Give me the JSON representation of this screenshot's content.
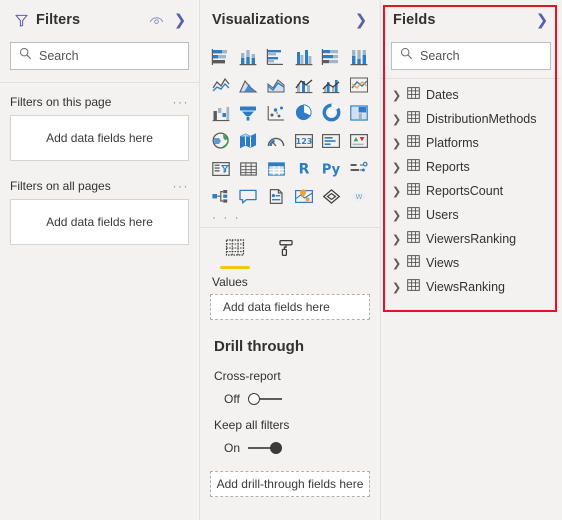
{
  "filters": {
    "title": "Filters",
    "eye_icon": "eye-icon",
    "expand_icon": "chevron-right-icon",
    "search": {
      "placeholder": "Search",
      "icon": "search-icon"
    },
    "groups": [
      {
        "label": "Filters on this page",
        "menu": "···",
        "dropzone": "Add data fields here"
      },
      {
        "label": "Filters on all pages",
        "menu": "···",
        "dropzone": "Add data fields here"
      }
    ]
  },
  "visualizations": {
    "title": "Visualizations",
    "expand_icon": "chevron-right-icon",
    "more_label": "· · ·",
    "icons": [
      "stacked-bar-chart-icon",
      "stacked-column-chart-icon",
      "clustered-bar-chart-icon",
      "clustered-column-chart-icon",
      "hundred-percent-stacked-bar-chart-icon",
      "hundred-percent-stacked-column-chart-icon",
      "line-chart-icon",
      "area-chart-icon",
      "stacked-area-chart-icon",
      "line-and-stacked-column-chart-icon",
      "line-and-clustered-column-chart-icon",
      "ribbon-chart-icon",
      "waterfall-chart-icon",
      "funnel-chart-icon",
      "scatter-chart-icon",
      "pie-chart-icon",
      "donut-chart-icon",
      "treemap-icon",
      "map-icon",
      "filled-map-icon",
      "gauge-icon",
      "card-icon",
      "multi-row-card-icon",
      "kpi-icon",
      "slicer-icon",
      "table-icon",
      "matrix-icon",
      "r-script-visual-icon",
      "python-visual-icon",
      "decomposition-tree-icon",
      "key-influencers-icon",
      "qanda-icon",
      "smart-narrative-icon",
      "arcgis-map-icon",
      "power-apps-icon",
      "word-cloud-icon"
    ],
    "tabs": [
      {
        "name": "fields-tab",
        "icon": "fields-table-icon",
        "active": true
      },
      {
        "name": "format-tab",
        "icon": "paint-roller-icon",
        "active": false
      }
    ],
    "values_label": "Values",
    "values_dropzone": "Add data fields here",
    "drill_through": {
      "title": "Drill through",
      "cross_report": {
        "label": "Cross-report",
        "state": "Off",
        "on": false
      },
      "keep_all_filters": {
        "label": "Keep all filters",
        "state": "On",
        "on": true
      },
      "dropzone": "Add drill-through fields here"
    }
  },
  "fields": {
    "title": "Fields",
    "expand_icon": "chevron-right-icon",
    "search": {
      "placeholder": "Search",
      "icon": "search-icon"
    },
    "tables": [
      {
        "name": "Dates",
        "icon": "table-icon",
        "chevron": "chevron-right-icon"
      },
      {
        "name": "DistributionMethods",
        "icon": "table-icon",
        "chevron": "chevron-right-icon"
      },
      {
        "name": "Platforms",
        "icon": "table-icon",
        "chevron": "chevron-right-icon"
      },
      {
        "name": "Reports",
        "icon": "table-icon",
        "chevron": "chevron-right-icon"
      },
      {
        "name": "ReportsCount",
        "icon": "table-icon",
        "chevron": "chevron-right-icon"
      },
      {
        "name": "Users",
        "icon": "table-icon",
        "chevron": "chevron-right-icon"
      },
      {
        "name": "ViewersRanking",
        "icon": "table-icon",
        "chevron": "chevron-right-icon"
      },
      {
        "name": "Views",
        "icon": "table-icon",
        "chevron": "chevron-right-icon"
      },
      {
        "name": "ViewsRanking",
        "icon": "table-icon",
        "chevron": "chevron-right-icon"
      }
    ]
  },
  "highlight": {
    "name": "fields-pane-highlight",
    "color": "#e81123"
  },
  "colors": {
    "panel_background": "#f3f2f1",
    "input_background": "#ffffff",
    "text": "#323130",
    "accent_yellow": "#f2c811",
    "icon_blue": "#2e7cc4",
    "icon_gray": "#5b5b5b",
    "highlight_red": "#e81123"
  }
}
